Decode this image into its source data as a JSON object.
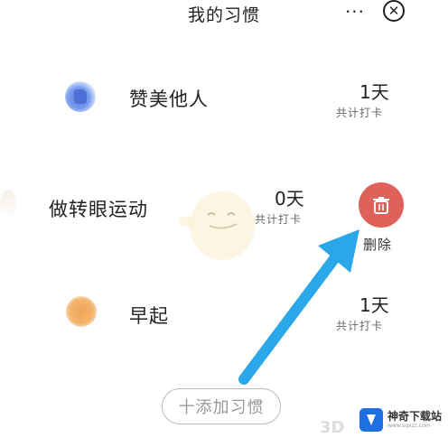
{
  "header": {
    "title": "我的习惯",
    "more_label": "···",
    "close_label": "✕"
  },
  "habits": [
    {
      "name": "赞美他人",
      "count": "1天",
      "sub": "共计打卡",
      "icon": "thumbs-up-icon"
    },
    {
      "name": "做转眼运动",
      "count": "0天",
      "sub": "共计打卡",
      "icon": "eye-icon"
    },
    {
      "name": "早起",
      "count": "1天",
      "sub": "共计打卡",
      "icon": "sun-icon"
    }
  ],
  "delete": {
    "label": "删除",
    "icon": "trash-icon",
    "color": "#e0605a"
  },
  "add_button": {
    "label": "十添加习惯"
  },
  "watermark": {
    "text": "3D",
    "brand_name": "神奇下载站",
    "brand_url": "www.sqxzz.com"
  },
  "colors": {
    "arrow": "#2aa7e8",
    "delete": "#e0605a"
  }
}
